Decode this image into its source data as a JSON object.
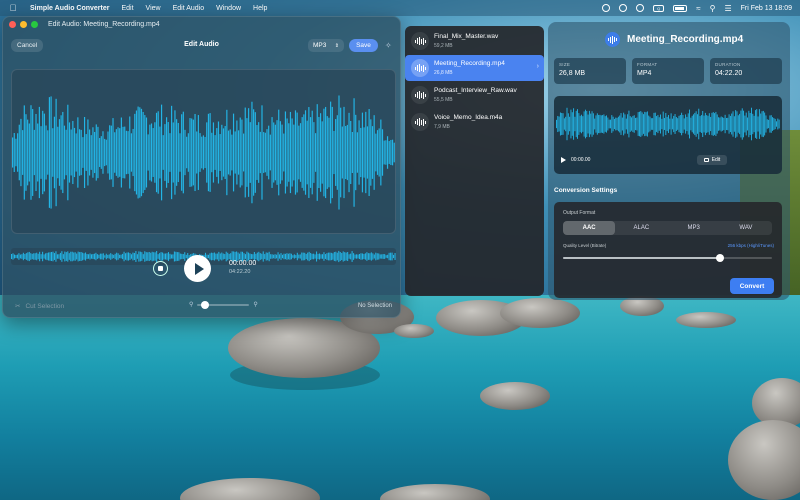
{
  "menubar": {
    "app_name": "Simple Audio Converter",
    "menus": [
      "Edit",
      "View",
      "Edit Audio",
      "Window",
      "Help"
    ],
    "clock": "Fri Feb 13  18:09"
  },
  "editor": {
    "window_title": "Edit Audio: Meeting_Recording.mp4",
    "toolbar": {
      "cancel_label": "Cancel",
      "title": "Edit Audio",
      "format_value": "MP3",
      "save_label": "Save"
    },
    "transport": {
      "current_time": "00:00.00",
      "total_time": "04:22.20"
    },
    "bottom": {
      "cut_selection_label": "Cut Selection",
      "selection_status": "No Selection",
      "zoom_level": 0.15
    },
    "waveform_color": "#23b5e6"
  },
  "files": [
    {
      "name": "Final_Mix_Master.wav",
      "size": "59,2 MB",
      "selected": false
    },
    {
      "name": "Meeting_Recording.mp4",
      "size": "26,8 MB",
      "selected": true
    },
    {
      "name": "Podcast_Interview_Raw.wav",
      "size": "55,5 MB",
      "selected": false
    },
    {
      "name": "Voice_Memo_Idea.m4a",
      "size": "7,9 MB",
      "selected": false
    }
  ],
  "details": {
    "title": "Meeting_Recording.mp4",
    "meta": [
      {
        "label": "SIZE",
        "value": "26,8 MB"
      },
      {
        "label": "FORMAT",
        "value": "MP4"
      },
      {
        "label": "DURATION",
        "value": "04:22.20"
      }
    ],
    "player_time": "00:00.00",
    "edit_label": "Edit",
    "conversion": {
      "heading": "Conversion Settings",
      "output_format_label": "Output Format",
      "formats": [
        "AAC",
        "ALAC",
        "MP3",
        "WAV"
      ],
      "selected_format": "AAC",
      "quality_label": "Quality Level (Bitrate)",
      "quality_value": "256 kbps (High/iTunes)",
      "quality_level": 0.75,
      "convert_label": "Convert"
    }
  },
  "colors": {
    "accent": "#4a83f0",
    "waveform": "#23b5e6",
    "convert": "#3d7ef2"
  }
}
